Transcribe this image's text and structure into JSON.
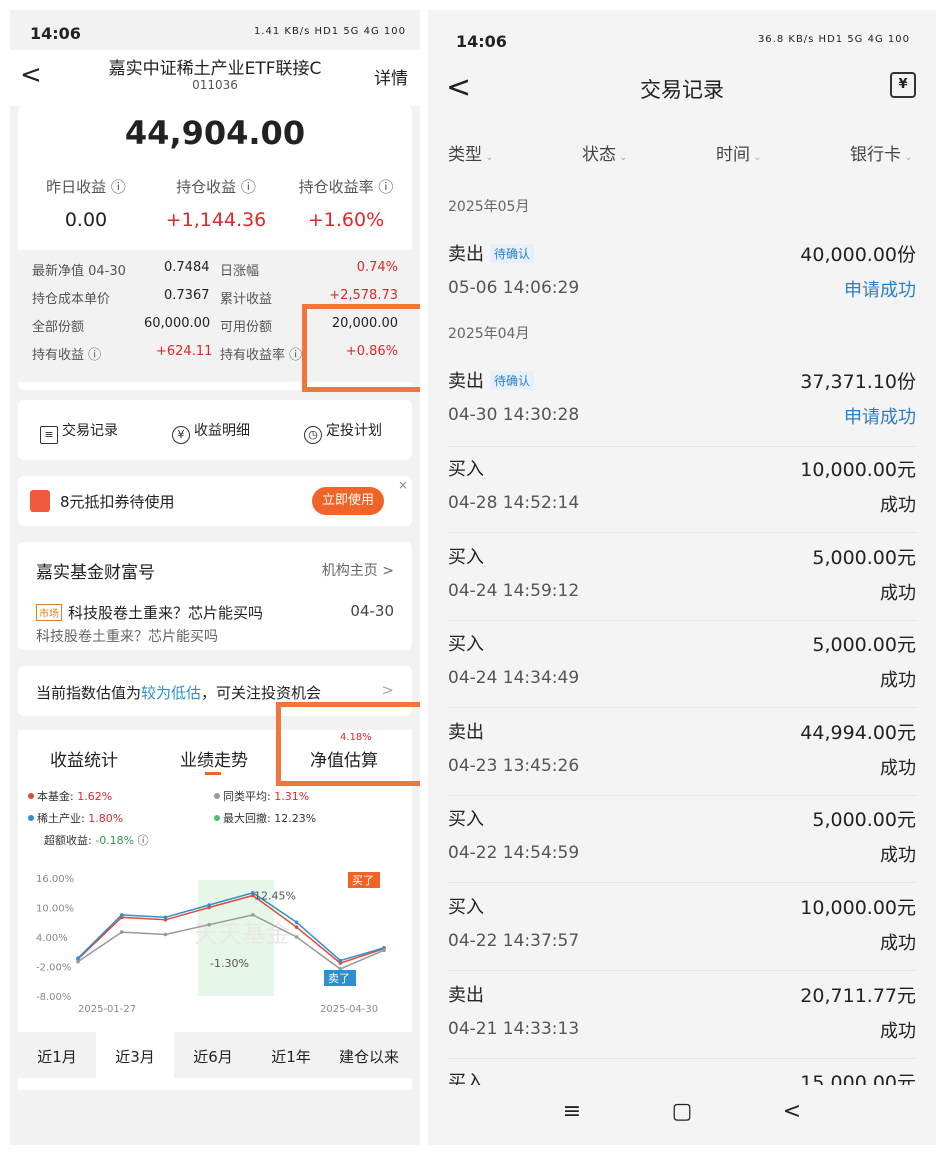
{
  "left": {
    "status": {
      "time": "14:06",
      "icons": "1.41 KB/s  HD1 5G 4G 100"
    },
    "header": {
      "title": "嘉实中证稀土产业ETF联接C",
      "code": "011036",
      "detail": "详情"
    },
    "amount": "44,904.00",
    "stats": [
      {
        "label": "昨日收益 ⓘ",
        "value": "0.00"
      },
      {
        "label": "持仓收益 ⓘ",
        "value": "+1,144.36"
      },
      {
        "label": "持仓收益率 ⓘ",
        "value": "+1.60%"
      }
    ],
    "grid": [
      {
        "k": "最新净值 04-30",
        "v": "0.7484",
        "k2": "日涨幅",
        "v2": "0.74%"
      },
      {
        "k": "持仓成本单价",
        "v": "0.7367",
        "k2": "累计收益",
        "v2": "+2,578.73"
      },
      {
        "k": "全部份额",
        "v": "60,000.00",
        "k2": "可用份额",
        "v2": "20,000.00"
      },
      {
        "k": "持有收益 ⓘ",
        "v": "+624.11",
        "k2": "持有收益率 ⓘ",
        "v2": "+0.86%"
      }
    ],
    "menu": [
      {
        "icon": "document-icon",
        "label": "交易记录"
      },
      {
        "icon": "yen-icon",
        "label": "收益明细"
      },
      {
        "icon": "timer-icon",
        "label": "定投计划"
      }
    ],
    "coupon": {
      "text": "8元抵扣券待使用",
      "button": "立即使用",
      "close": "×"
    },
    "news": {
      "title": "嘉实基金财富号",
      "link": "机构主页 >",
      "tag": "市场",
      "headline": "科技股卷土重来？芯片能买吗",
      "date": "04-30",
      "sub": "科技股卷土重来？芯片能买吗"
    },
    "hint": {
      "pre": "当前指数估值为",
      "hl": "较为低估",
      "post": "，可关注投资机会"
    },
    "chart_tabs": [
      "收益统计",
      "业绩走势",
      "净值估算"
    ],
    "chart_tab_badge": "4.18%",
    "legend": [
      {
        "label": "本基金:",
        "value": "1.62%",
        "color": "#e04a3a"
      },
      {
        "label": "同类平均:",
        "value": "1.31%",
        "color": "#999999"
      },
      {
        "label": "稀土产业:",
        "value": "1.80%",
        "color": "#2b8fd0"
      },
      {
        "label": "最大回撤:",
        "value": "12.23%",
        "color": "#4cc06a"
      },
      {
        "label": "超额收益:",
        "value": "-0.18%",
        "color": "#4cc06a"
      }
    ],
    "periods": [
      "近1月",
      "近3月",
      "近6月",
      "近1年",
      "建仓以来"
    ],
    "colors": {
      "red": "#e0282a",
      "orange": "#f0763c",
      "blue": "#2b7fc8"
    }
  },
  "chart_data": {
    "type": "line",
    "x": [
      "2025-01-27",
      "2025-02-10",
      "2025-02-24",
      "2025-03-10",
      "2025-03-24",
      "2025-04-07",
      "2025-04-21",
      "2025-04-30"
    ],
    "series": [
      {
        "name": "本基金",
        "values": [
          -0.5,
          8.0,
          7.5,
          10.0,
          12.45,
          6.0,
          -1.3,
          1.62
        ]
      },
      {
        "name": "稀土产业",
        "values": [
          -0.3,
          8.5,
          8.0,
          10.5,
          13.0,
          7.0,
          -0.8,
          1.8
        ]
      },
      {
        "name": "同类平均",
        "values": [
          -1.0,
          5.0,
          4.5,
          6.5,
          8.5,
          4.0,
          -2.5,
          1.31
        ]
      }
    ],
    "ylim": [
      -8.0,
      16.0
    ],
    "yticks": [
      "16.00%",
      "10.00%",
      "4.00%",
      "-2.00%",
      "-8.00%"
    ],
    "xticks": [
      "2025-01-27",
      "2025-04-30"
    ],
    "annotations": [
      "12.45%",
      "-1.30%",
      "买了",
      "卖了"
    ],
    "watermark": "天天基金"
  },
  "right": {
    "status": {
      "time": "14:06",
      "icons": "36.8 KB/s  HD1 5G 4G 100"
    },
    "title": "交易记录",
    "cal_icon": "¥",
    "filters": [
      "类型",
      "状态",
      "时间",
      "银行卡"
    ],
    "months": [
      "2025年05月",
      "2025年04月"
    ],
    "tx": [
      {
        "type": "卖出",
        "tag": "待确认",
        "amount": "40,000.00份",
        "date": "05-06 14:06:29",
        "status": "申请成功"
      },
      {
        "type": "卖出",
        "tag": "待确认",
        "amount": "37,371.10份",
        "date": "04-30 14:30:28",
        "status": "申请成功"
      },
      {
        "type": "买入",
        "tag": "",
        "amount": "10,000.00元",
        "date": "04-28 14:52:14",
        "status": "成功"
      },
      {
        "type": "买入",
        "tag": "",
        "amount": "5,000.00元",
        "date": "04-24 14:59:12",
        "status": "成功"
      },
      {
        "type": "买入",
        "tag": "",
        "amount": "5,000.00元",
        "date": "04-24 14:34:49",
        "status": "成功"
      },
      {
        "type": "卖出",
        "tag": "",
        "amount": "44,994.00元",
        "date": "04-23 13:45:26",
        "status": "成功"
      },
      {
        "type": "买入",
        "tag": "",
        "amount": "5,000.00元",
        "date": "04-22 14:54:59",
        "status": "成功"
      },
      {
        "type": "买入",
        "tag": "",
        "amount": "10,000.00元",
        "date": "04-22 14:37:57",
        "status": "成功"
      },
      {
        "type": "卖出",
        "tag": "",
        "amount": "20,711.77元",
        "date": "04-21 14:33:13",
        "status": "成功"
      },
      {
        "type": "买入",
        "tag": "",
        "amount": "15,000.00元",
        "date": "",
        "status": ""
      }
    ],
    "bottom": [
      "≡",
      "▢",
      "<"
    ]
  }
}
